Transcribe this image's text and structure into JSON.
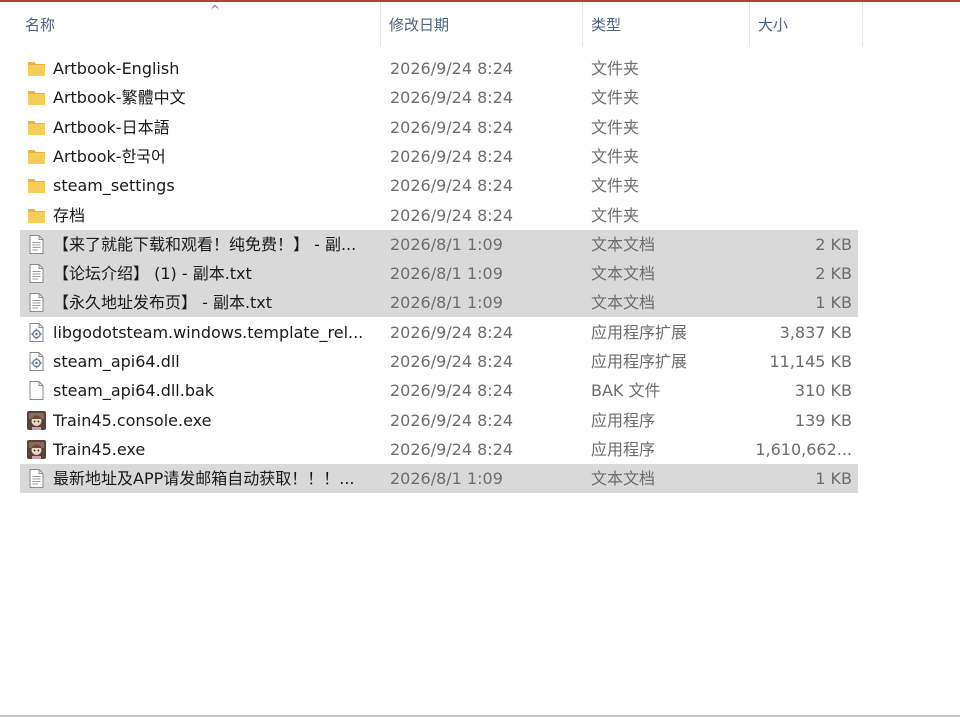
{
  "columns": {
    "name": "名称",
    "date": "修改日期",
    "type": "类型",
    "size": "大小",
    "sort_indicator": "^"
  },
  "rows": [
    {
      "name": "Artbook-English",
      "date": "2026/9/24 8:24",
      "type": "文件夹",
      "size": "",
      "icon": "folder-icon",
      "selected": false
    },
    {
      "name": "Artbook-繁體中文",
      "date": "2026/9/24 8:24",
      "type": "文件夹",
      "size": "",
      "icon": "folder-icon",
      "selected": false
    },
    {
      "name": "Artbook-日本語",
      "date": "2026/9/24 8:24",
      "type": "文件夹",
      "size": "",
      "icon": "folder-icon",
      "selected": false
    },
    {
      "name": "Artbook-한국어",
      "date": "2026/9/24 8:24",
      "type": "文件夹",
      "size": "",
      "icon": "folder-icon",
      "selected": false
    },
    {
      "name": "steam_settings",
      "date": "2026/9/24 8:24",
      "type": "文件夹",
      "size": "",
      "icon": "folder-icon",
      "selected": false
    },
    {
      "name": "存档",
      "date": "2026/9/24 8:24",
      "type": "文件夹",
      "size": "",
      "icon": "folder-icon",
      "selected": false
    },
    {
      "name": "【来了就能下载和观看！纯免费！】 - 副...",
      "date": "2026/8/1 1:09",
      "type": "文本文档",
      "size": "2 KB",
      "icon": "text-file-icon",
      "selected": true
    },
    {
      "name": "【论坛介绍】 (1) - 副本.txt",
      "date": "2026/8/1 1:09",
      "type": "文本文档",
      "size": "2 KB",
      "icon": "text-file-icon",
      "selected": true
    },
    {
      "name": "【永久地址发布页】 - 副本.txt",
      "date": "2026/8/1 1:09",
      "type": "文本文档",
      "size": "1 KB",
      "icon": "text-file-icon",
      "selected": true
    },
    {
      "name": "libgodotsteam.windows.template_rel...",
      "date": "2026/9/24 8:24",
      "type": "应用程序扩展",
      "size": "3,837 KB",
      "icon": "dll-file-icon",
      "selected": false
    },
    {
      "name": "steam_api64.dll",
      "date": "2026/9/24 8:24",
      "type": "应用程序扩展",
      "size": "11,145 KB",
      "icon": "dll-file-icon",
      "selected": false
    },
    {
      "name": "steam_api64.dll.bak",
      "date": "2026/9/24 8:24",
      "type": "BAK 文件",
      "size": "310 KB",
      "icon": "blank-file-icon",
      "selected": false
    },
    {
      "name": "Train45.console.exe",
      "date": "2026/9/24 8:24",
      "type": "应用程序",
      "size": "139 KB",
      "icon": "app-exe-icon",
      "selected": false
    },
    {
      "name": "Train45.exe",
      "date": "2026/9/24 8:24",
      "type": "应用程序",
      "size": "1,610,662...",
      "icon": "app-exe-icon",
      "selected": false
    },
    {
      "name": "最新地址及APP请发邮箱自动获取！！！...",
      "date": "2026/8/1 1:09",
      "type": "文本文档",
      "size": "1 KB",
      "icon": "text-file-icon",
      "selected": true
    }
  ],
  "colors": {
    "selection": "#d9d9d9",
    "header_text": "#4d6082",
    "folder": "#f7cd5a",
    "top_accent": "#b7412f"
  }
}
